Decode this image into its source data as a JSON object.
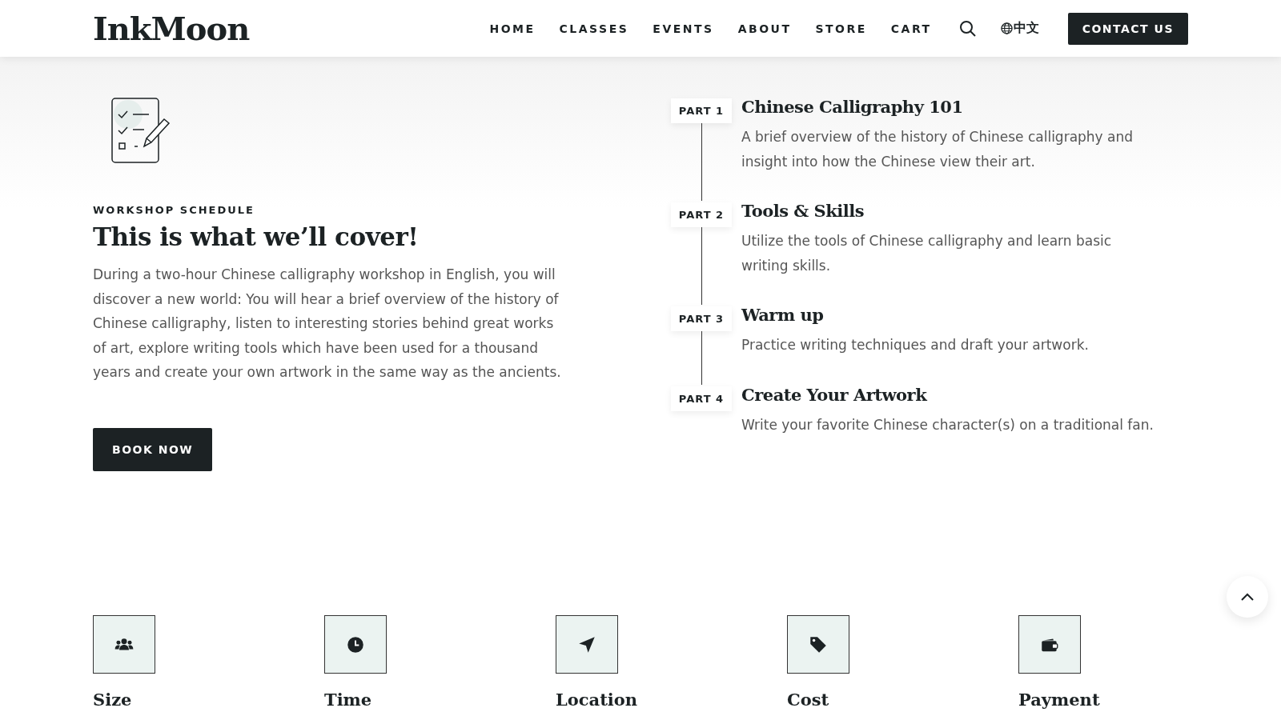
{
  "header": {
    "logo": "InkMoon",
    "nav": [
      {
        "label": "HOME",
        "selected": false
      },
      {
        "label": "CLASSES",
        "selected": false
      },
      {
        "label": "EVENTS",
        "selected": false
      },
      {
        "label": "ABOUT",
        "selected": false
      },
      {
        "label": "STORE",
        "selected": false
      },
      {
        "label": "CART",
        "selected": false
      }
    ],
    "language": "中文",
    "contact_button": "CONTACT US"
  },
  "schedule": {
    "eyebrow": "WORKSHOP SCHEDULE",
    "title": "This is what we’ll cover!",
    "description": "During a two-hour Chinese calligraphy workshop in English, you will discover a new world: You will hear a brief overview of the history of Chinese calligraphy, listen to interesting stories behind great works of art, explore writing tools which have been used for a thousand years and create your own artwork in the same way as the ancients.",
    "button": "BOOK NOW"
  },
  "parts": [
    {
      "badge": "PART 1",
      "title": "Chinese Calligraphy 101",
      "text": "A brief overview of the history of Chinese calligraphy and insight into how the Chinese view their art."
    },
    {
      "badge": "PART 2",
      "title": "Tools & Skills",
      "text": "Utilize the tools of Chinese calligraphy and learn basic writing skills."
    },
    {
      "badge": "PART 3",
      "title": "Warm up",
      "text": "Practice writing techniques and draft your artwork."
    },
    {
      "badge": "PART 4",
      "title": "Create Your Artwork",
      "text": "Write your favorite Chinese character(s) on a traditional fan."
    }
  ],
  "features": [
    {
      "kind": "size",
      "title": "Size"
    },
    {
      "kind": "time",
      "title": "Time"
    },
    {
      "kind": "location",
      "title": "Location"
    },
    {
      "kind": "cost",
      "title": "Cost"
    },
    {
      "kind": "payment",
      "title": "Payment"
    }
  ]
}
